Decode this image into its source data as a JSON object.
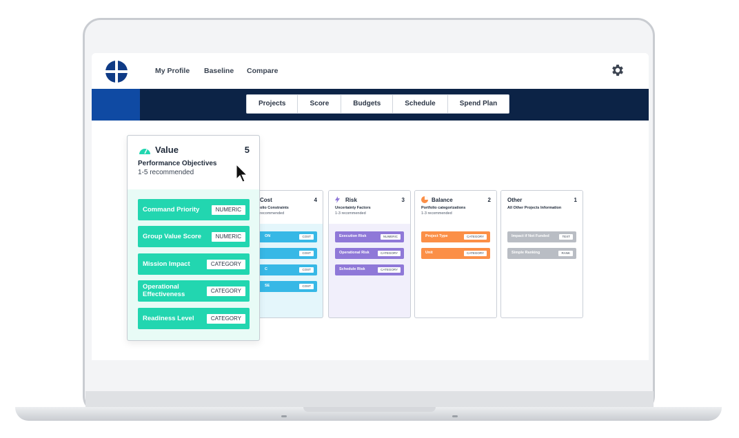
{
  "nav": {
    "links": [
      "My Profile",
      "Baseline",
      "Compare"
    ]
  },
  "tabs": [
    "Projects",
    "Score",
    "Budgets",
    "Schedule",
    "Spend Plan"
  ],
  "value_card": {
    "title": "Value",
    "count": "5",
    "subtitle": "Performance Objectives",
    "recommended": "1-5 recommended",
    "items": [
      {
        "label": "Command Priority",
        "tag": "NUMERIC"
      },
      {
        "label": "Group Value Score",
        "tag": "NUMERIC"
      },
      {
        "label": "Mission Impact",
        "tag": "CATEGORY"
      },
      {
        "label": "Operational Effectiveness",
        "tag": "CATEGORY"
      },
      {
        "label": "Readiness Level",
        "tag": "CATEGORY"
      }
    ]
  },
  "cost_card": {
    "title": "Cost",
    "count": "4",
    "subtitle": "olio Constraints",
    "recommended": "recommended",
    "items": [
      {
        "label": "ON",
        "tag": "COST"
      },
      {
        "label": "",
        "tag": "COST"
      },
      {
        "label": "C",
        "tag": "COST"
      },
      {
        "label": "SE",
        "tag": "COST"
      }
    ]
  },
  "risk_card": {
    "title": "Risk",
    "count": "3",
    "subtitle": "Uncertainty Factors",
    "recommended": "1-3 recommended",
    "items": [
      {
        "label": "Execution Risk",
        "tag": "NUMERIC"
      },
      {
        "label": "Operational Risk",
        "tag": "CATEGORY"
      },
      {
        "label": "Schedule Risk",
        "tag": "CATEGORY"
      }
    ]
  },
  "balance_card": {
    "title": "Balance",
    "count": "2",
    "subtitle": "Portfolio categorizations",
    "recommended": "1-3 recommended",
    "items": [
      {
        "label": "Project Type",
        "tag": "CATEGORY"
      },
      {
        "label": "Unit",
        "tag": "CATEGORY"
      }
    ]
  },
  "other_card": {
    "title": "Other",
    "count": "1",
    "subtitle": "All Other Projects Information",
    "items": [
      {
        "label": "Impact if Not Funded",
        "tag": "TEXT"
      },
      {
        "label": "Simple Ranking",
        "tag": "RANK"
      }
    ]
  },
  "colors": {
    "value": "#22d6b0",
    "cost": "#37b8e6",
    "risk": "#8f78d8",
    "balance": "#fb8f47",
    "other": "#b9bdc4",
    "navbar": "#0c2346"
  }
}
